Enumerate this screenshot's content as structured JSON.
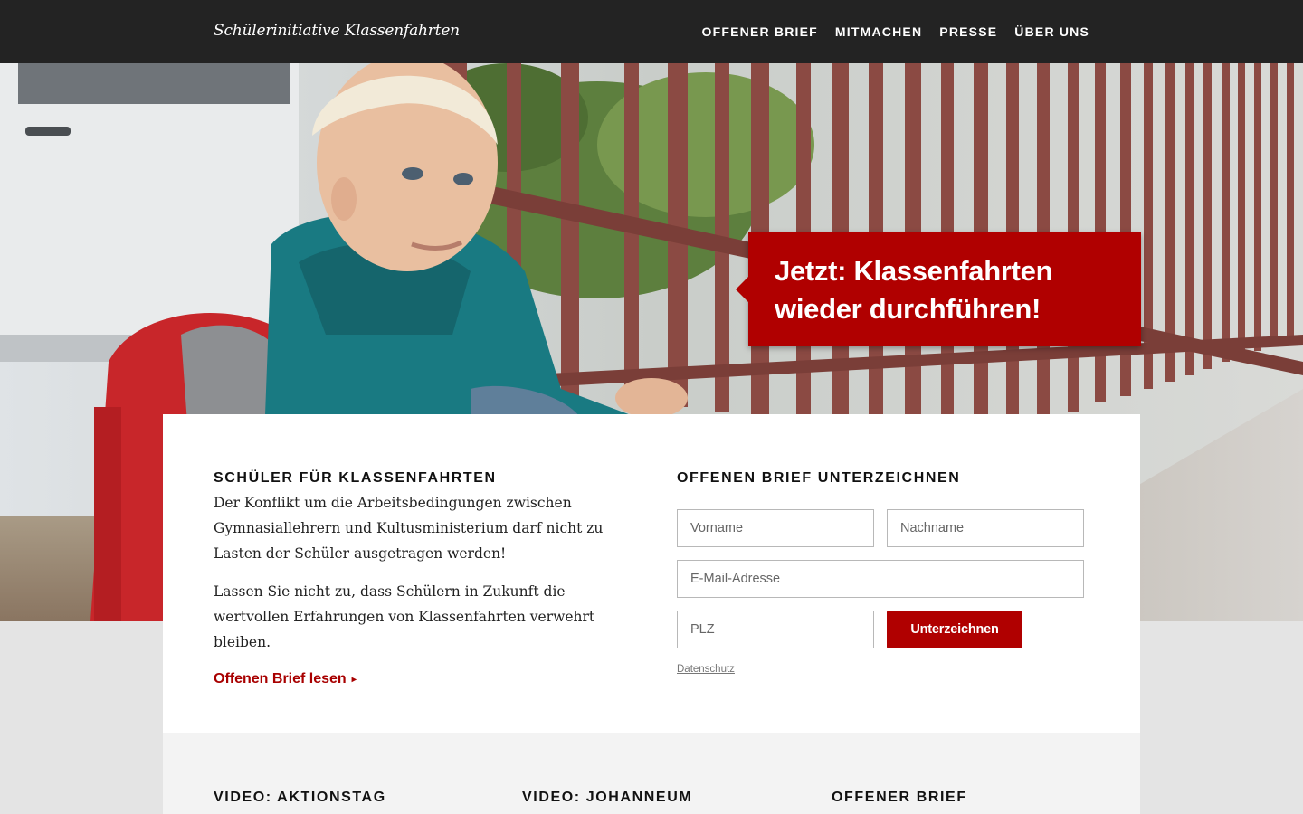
{
  "header": {
    "brand": "Schülerinitiative Klassenfahrten",
    "nav": [
      "OFFENER BRIEF",
      "MITMACHEN",
      "PRESSE",
      "ÜBER UNS"
    ]
  },
  "hero": {
    "callout_line1": "Jetzt: Klassenfahrten",
    "callout_line2": "wieder durchführen!"
  },
  "intro": {
    "heading": "SCHÜLER FÜR KLASSENFAHRTEN",
    "paragraph1": "Der Konflikt um die Arbeitsbedingungen zwischen Gymnasiallehrern und Kultusministerium darf nicht zu Lasten der Schüler ausgetragen werden!",
    "paragraph2": "Lassen Sie nicht zu, dass Schülern in Zukunft die wertvollen Erfahrungen von Klassenfahrten verwehrt bleiben.",
    "link": "Offenen Brief lesen",
    "link_arrow": "▸"
  },
  "form": {
    "heading": "OFFENEN BRIEF UNTERZEICHNEN",
    "first_name_placeholder": "Vorname",
    "last_name_placeholder": "Nachname",
    "email_placeholder": "E-Mail-Adresse",
    "zip_placeholder": "PLZ",
    "submit": "Unterzeichnen",
    "privacy": "Datenschutz"
  },
  "teasers": [
    "VIDEO: AKTIONSTAG",
    "VIDEO: JOHANNEUM",
    "OFFENER BRIEF"
  ],
  "colors": {
    "accent": "#b00000",
    "nav_bg": "#232323",
    "page_bg": "#e4e4e4"
  }
}
